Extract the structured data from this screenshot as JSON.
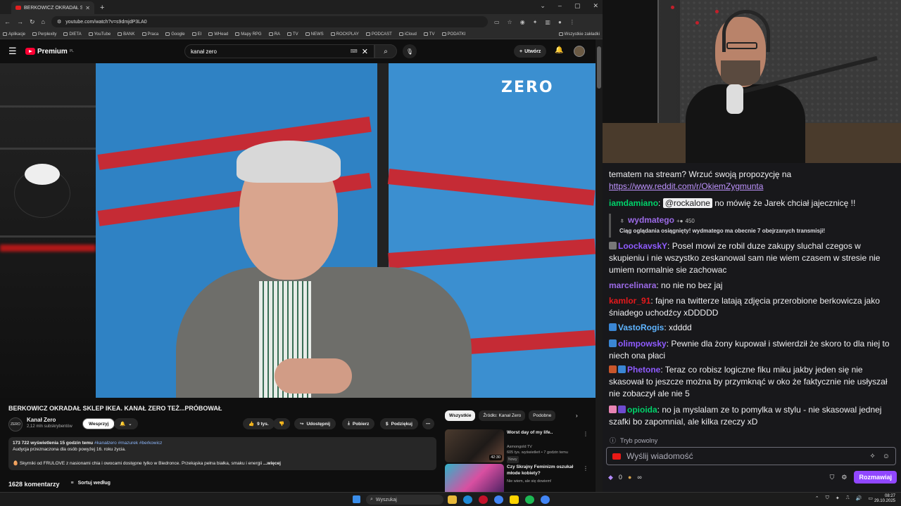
{
  "browser": {
    "tab_title": "BERKOWICZ OKRADAŁ SKLEP IK",
    "url": "youtube.com/watch?v=s9dmjdP3LA0",
    "bookmarks": [
      "Aplikacje",
      "Perplexity",
      "DIETA",
      "YouTube",
      "BANK",
      "Praca",
      "Google",
      "EI",
      "WHead",
      "Mapy RPG",
      "RA",
      "TV",
      "NEWS",
      "ROCKPLAY",
      "PODCAST",
      "iCloud",
      "TV",
      "PODATKI"
    ],
    "bookmarks_all": "Wszystkie zakładki"
  },
  "youtube": {
    "logo": "Premium",
    "logo_sup": "PL",
    "search_value": "kanał zero",
    "create_label": "Utwórz"
  },
  "video": {
    "overlay_logo": "ZERO",
    "title": "BERKOWICZ OKRADAŁ SKLEP IKEA. KANAŁ ZERO TEŻ...PRÓBOWAŁ",
    "channel_logo": "ZERO",
    "channel": "Kanał Zero",
    "subscribers": "2,12 mln subskrybentów",
    "join_label": "Wesprzyj",
    "likes": "9 tys.",
    "share_label": "Udostępnij",
    "download_label": "Pobierz",
    "thanks_label": "Podziękuj",
    "desc_meta": "173 722 wyświetlenia  15 godzin temu",
    "desc_tags": "#kanałzero #mazurek #berkowicz",
    "desc_audience": "Audycja przeznaczona dla osób powyżej 16. roku życia.",
    "desc_promo": "🥚 Skyrniki od FRULOVE z nasionami chia i owocami dostępne tylko w Biedronce. Przekąska pełna białka, smaku i energii",
    "desc_more": "...więcej",
    "comments_count": "1628 komentarzy",
    "sort_label": "Sortuj według"
  },
  "sidebar": {
    "chips": [
      "Wszystkie",
      "Źródło: Kanał Zero",
      "Podobne"
    ],
    "recs": [
      {
        "title": "Worst day of my life..",
        "channel": "Asmongold TV",
        "meta": "605 tys. wyświetleń • 7 godzin temu",
        "badge": "Nowy",
        "duration": "42:30"
      },
      {
        "title": "Czy Skrajny Feminizm oszukał młode kobiety?",
        "channel": "Nie wiem, ale się dowiem!",
        "meta": "",
        "badge": "",
        "duration": ""
      }
    ]
  },
  "chat": {
    "continuation": "tematem na stream? Wrzuć swoją propozycję na",
    "link": "https://www.reddit.com/r/OkiemZygmunta",
    "messages": [
      {
        "user": "iamdamiano",
        "color": "#00d26a",
        "mention": "@rockalone",
        "text": " no mówię że Jarek chciał jajecznicę !!"
      },
      {
        "user": "LoockavskY",
        "color": "#8f5bff",
        "text": ": Posel mowi ze robil duze zakupy sluchal czegos w skupieniu i nie wszystko zeskanowal sam nie wiem czasem w stresie nie umiem normalnie sie zachowac"
      },
      {
        "user": "marcelinara",
        "color": "#9b6ae6",
        "text": ": no nie no bez jaj"
      },
      {
        "user": "kamlor_91",
        "color": "#e5191c",
        "text": ": fajne na twitterze latają zdjęcia przerobione berkowicza jako śniadego uchodźcy xDDDDD"
      },
      {
        "user": "VastoRogis",
        "color": "#5fb4ff",
        "text": ": xdddd"
      },
      {
        "user": "olimpowsky",
        "color": "#8f5bff",
        "text": ": Pewnie dla żony kupował i stwierdził że skoro to dla niej to niech ona płaci"
      },
      {
        "user": "Phetone",
        "color": "#8f5bff",
        "text": ": Teraz co robisz logiczne fiku miku jakby jeden się nie skasował to jeszcze można by przymknąć w oko że faktycznie nie usłyszał nie zobaczył ale nie 5"
      },
      {
        "user": "opioida",
        "color": "#00d26a",
        "text": ": no ja myslalam ze to pomylka w stylu - nie skasowal jednej szafki bo zapomnial, ale kilka rzeczy xD"
      }
    ],
    "system": {
      "user": "wydmatego",
      "points": "450",
      "text": "Ciąg oglądania osiągnięty! wydmatego ma obecnie 7 obejrzanych transmisji!"
    },
    "mode_label": "Tryb powolny",
    "input_placeholder": "Wyślij wiadomość",
    "points": "0",
    "send_label": "Rozmawiaj"
  },
  "taskbar": {
    "search_placeholder": "Wyszukaj",
    "time": "08:27",
    "date": "29.10.2025"
  }
}
